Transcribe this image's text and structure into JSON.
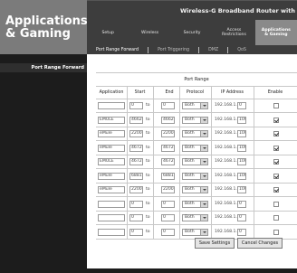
{
  "header": {
    "section_title_line1": "Applications",
    "section_title_line2": "& Gaming",
    "product_title": "Wireless-G Broadband Router with",
    "nav_tabs": [
      {
        "label": "Setup",
        "active": false
      },
      {
        "label": "Wireless",
        "active": false
      },
      {
        "label": "Security",
        "active": false
      },
      {
        "label": "Access\nRestrictions",
        "active": false
      },
      {
        "label": "Applications\n& Gaming",
        "active": true
      }
    ],
    "sub_tabs": [
      {
        "label": "Port Range Forward",
        "active": true
      },
      {
        "label": "Port Triggering",
        "active": false
      },
      {
        "label": "DMZ",
        "active": false
      },
      {
        "label": "QoS",
        "active": false
      }
    ]
  },
  "sidebar": {
    "section_label": "Port Range Forward"
  },
  "table": {
    "title": "Port Range",
    "columns": [
      "Application",
      "Start",
      "",
      "End",
      "Protocol",
      "IP Address",
      "Enable"
    ],
    "to_label": "to",
    "ip_prefix": "192.168.1.",
    "rows": [
      {
        "application": "",
        "start": "0",
        "end": "0",
        "protocol": "Both",
        "ip_last": "0",
        "enabled": false
      },
      {
        "application": "EMULE",
        "start": "4662",
        "end": "4662",
        "protocol": "Both",
        "ip_last": "100",
        "enabled": true
      },
      {
        "application": "eMule",
        "start": "22003",
        "end": "22003",
        "protocol": "Both",
        "ip_last": "100",
        "enabled": true
      },
      {
        "application": "eMule",
        "start": "4672",
        "end": "4672",
        "protocol": "Both",
        "ip_last": "100",
        "enabled": true
      },
      {
        "application": "EMULE",
        "start": "4672",
        "end": "4672",
        "protocol": "Both",
        "ip_last": "100",
        "enabled": true
      },
      {
        "application": "eMule",
        "start": "6881",
        "end": "6881",
        "protocol": "Both",
        "ip_last": "100",
        "enabled": true
      },
      {
        "application": "eMule",
        "start": "22003",
        "end": "22003",
        "protocol": "Both",
        "ip_last": "100",
        "enabled": true
      },
      {
        "application": "",
        "start": "0",
        "end": "0",
        "protocol": "Both",
        "ip_last": "0",
        "enabled": false
      },
      {
        "application": "",
        "start": "0",
        "end": "0",
        "protocol": "Both",
        "ip_last": "0",
        "enabled": false
      },
      {
        "application": "",
        "start": "0",
        "end": "0",
        "protocol": "Both",
        "ip_last": "0",
        "enabled": false
      }
    ]
  },
  "footer": {
    "save_label": "Save Settings",
    "cancel_label": "Cancel Changes"
  }
}
